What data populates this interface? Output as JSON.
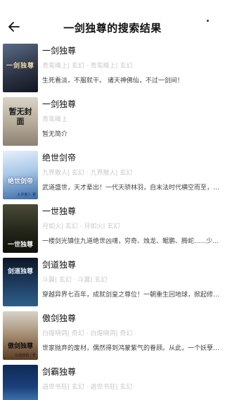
{
  "header": {
    "title": "一剑独尊的搜索结果",
    "back_icon": "arrow-left-icon"
  },
  "results": [
    {
      "title": "一剑独尊",
      "meta": "青鸾峰上| 玄幻 · 青鸾峰上| 玄幻",
      "desc": "生死看淡，不服就干。 诸天神佛仙，不过一剑间！",
      "cover_text": "一剑独尊",
      "cover_colors": [
        "#2b3242",
        "#6e7c93"
      ]
    },
    {
      "title": "一剑独尊",
      "meta": "青鸾峰上",
      "desc": "暂无简介",
      "cover_text": "暂无封面",
      "cover_colors": [
        "#d8d1c4",
        "#9a8f80"
      ]
    },
    {
      "title": "绝世剑帝",
      "meta": "九界散人| 玄幻 · 九界散人| 玄幻",
      "desc": "武道盛世，天才辈出！一代天骄林羽，自末法时代横空而至，横推...",
      "cover_text": "绝世剑帝",
      "cover_author": "九界散人 著",
      "cover_colors": [
        "#bcd6ee",
        "#3a6aa6"
      ]
    },
    {
      "title": "一世独尊",
      "meta": "月如火| 玄幻 · 月如火| 玄幻",
      "desc": "一楼剑光镇住九道绝世凶魂，穷奇、烛龙、鲲鹏、腾蛇......少年...",
      "cover_text": "一世独尊",
      "cover_colors": [
        "#1e2216",
        "#6b6a3c"
      ]
    },
    {
      "title": "剑道独尊",
      "meta": "斗翼| 玄幻 · 斗翼| 玄幻",
      "desc": "穿越异界七百年，成就剑皇之尊位！一朝重生回地球，掀起修炼界...",
      "cover_text": "剑道独尊",
      "cover_colors": [
        "#0e1a2a",
        "#2e5f8a"
      ]
    },
    {
      "title": "傲剑独尊",
      "meta": "白煌晓鸽| 奇幻 · 白煌晓鸽| 奇幻",
      "desc": "世家抛弃的废材，偶然得到鸿蒙紫气的眷顾。从此，一个妖孽般的...",
      "cover_text": "傲剑独尊",
      "cover_author": "白煌晓鸽 / 著",
      "cover_colors": [
        "#e9e4dc",
        "#7b4a2a"
      ]
    },
    {
      "title": "剑霸独尊",
      "meta": "逍世书狂| 玄幻 · 逍世书狂| 玄幻",
      "desc": "",
      "cover_text": "",
      "cover_colors": [
        "#1a3f7a",
        "#5fa0d8"
      ]
    }
  ]
}
